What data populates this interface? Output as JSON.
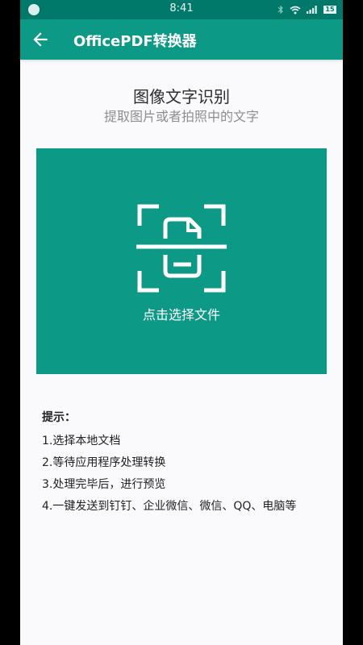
{
  "status_bar": {
    "time": "8:41",
    "battery": "15"
  },
  "toolbar": {
    "title": "OfficePDF转换器"
  },
  "main": {
    "title": "图像文字识别",
    "subtitle": "提取图片或者拍照中的文字",
    "select_label": "点击选择文件"
  },
  "tips": {
    "heading": "提示：",
    "items": [
      "1.选择本地文档",
      "2.等待应用程序处理转换",
      "3.处理完毕后，进行预览",
      "4.一键发送到钉钉、企业微信、微信、QQ、电脑等"
    ]
  },
  "colors": {
    "status_bar": "#00796b",
    "toolbar": "#0c9a86",
    "accent": "#0c9a86",
    "background": "#faf9fb"
  },
  "icons": {
    "back": "arrow-left-icon",
    "scan": "document-scan-icon"
  }
}
